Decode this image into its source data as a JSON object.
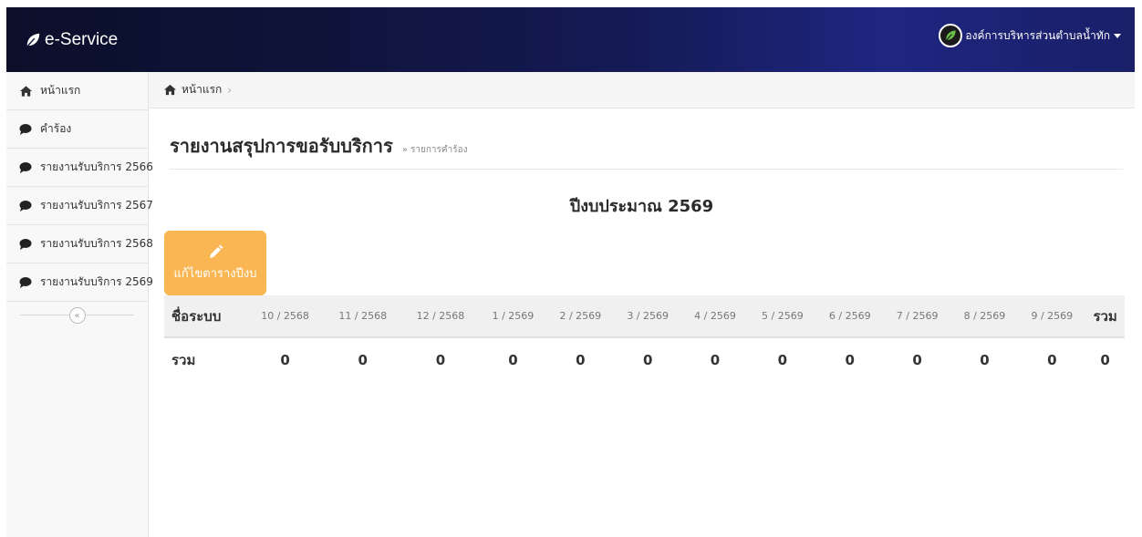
{
  "navbar": {
    "brand": "e-Service",
    "user_name": "องค์การบริหารส่วนตำบลน้ำทัก"
  },
  "sidebar": {
    "items": [
      {
        "label": "หน้าแรก",
        "icon": "home-icon"
      },
      {
        "label": "คำร้อง",
        "icon": "chat-bubble-icon"
      },
      {
        "label": "รายงานรับบริการ 2566",
        "icon": "chat-bubble-icon"
      },
      {
        "label": "รายงานรับบริการ 2567",
        "icon": "chat-bubble-icon"
      },
      {
        "label": "รายงานรับบริการ 2568",
        "icon": "chat-bubble-icon"
      },
      {
        "label": "รายงานรับบริการ 2569",
        "icon": "chat-bubble-icon"
      }
    ],
    "collapse_label": "«"
  },
  "breadcrumb": {
    "home": "หน้าแรก",
    "separator": "›"
  },
  "page": {
    "title": "รายงานสรุปการขอรับบริการ",
    "subtitle": "» รายการคำร้อง",
    "year_heading": "ปีงบประมาณ 2569",
    "edit_button": "แก้ไขตารางปีงบ"
  },
  "table": {
    "name_header": "ชื่อระบบ",
    "months": [
      "10 / 2568",
      "11 / 2568",
      "12 / 2568",
      "1 / 2569",
      "2 / 2569",
      "3 / 2569",
      "4 / 2569",
      "5 / 2569",
      "6 / 2569",
      "7 / 2569",
      "8 / 2569",
      "9 / 2569"
    ],
    "total_header": "รวม",
    "rows": [
      {
        "name": "รวม",
        "values": [
          "0",
          "0",
          "0",
          "0",
          "0",
          "0",
          "0",
          "0",
          "0",
          "0",
          "0",
          "0"
        ],
        "total": "0"
      }
    ]
  },
  "colors": {
    "navbar_dark": "#0b0f2a",
    "navbar_light": "#1f2680",
    "edit_button": "#f9b653"
  }
}
